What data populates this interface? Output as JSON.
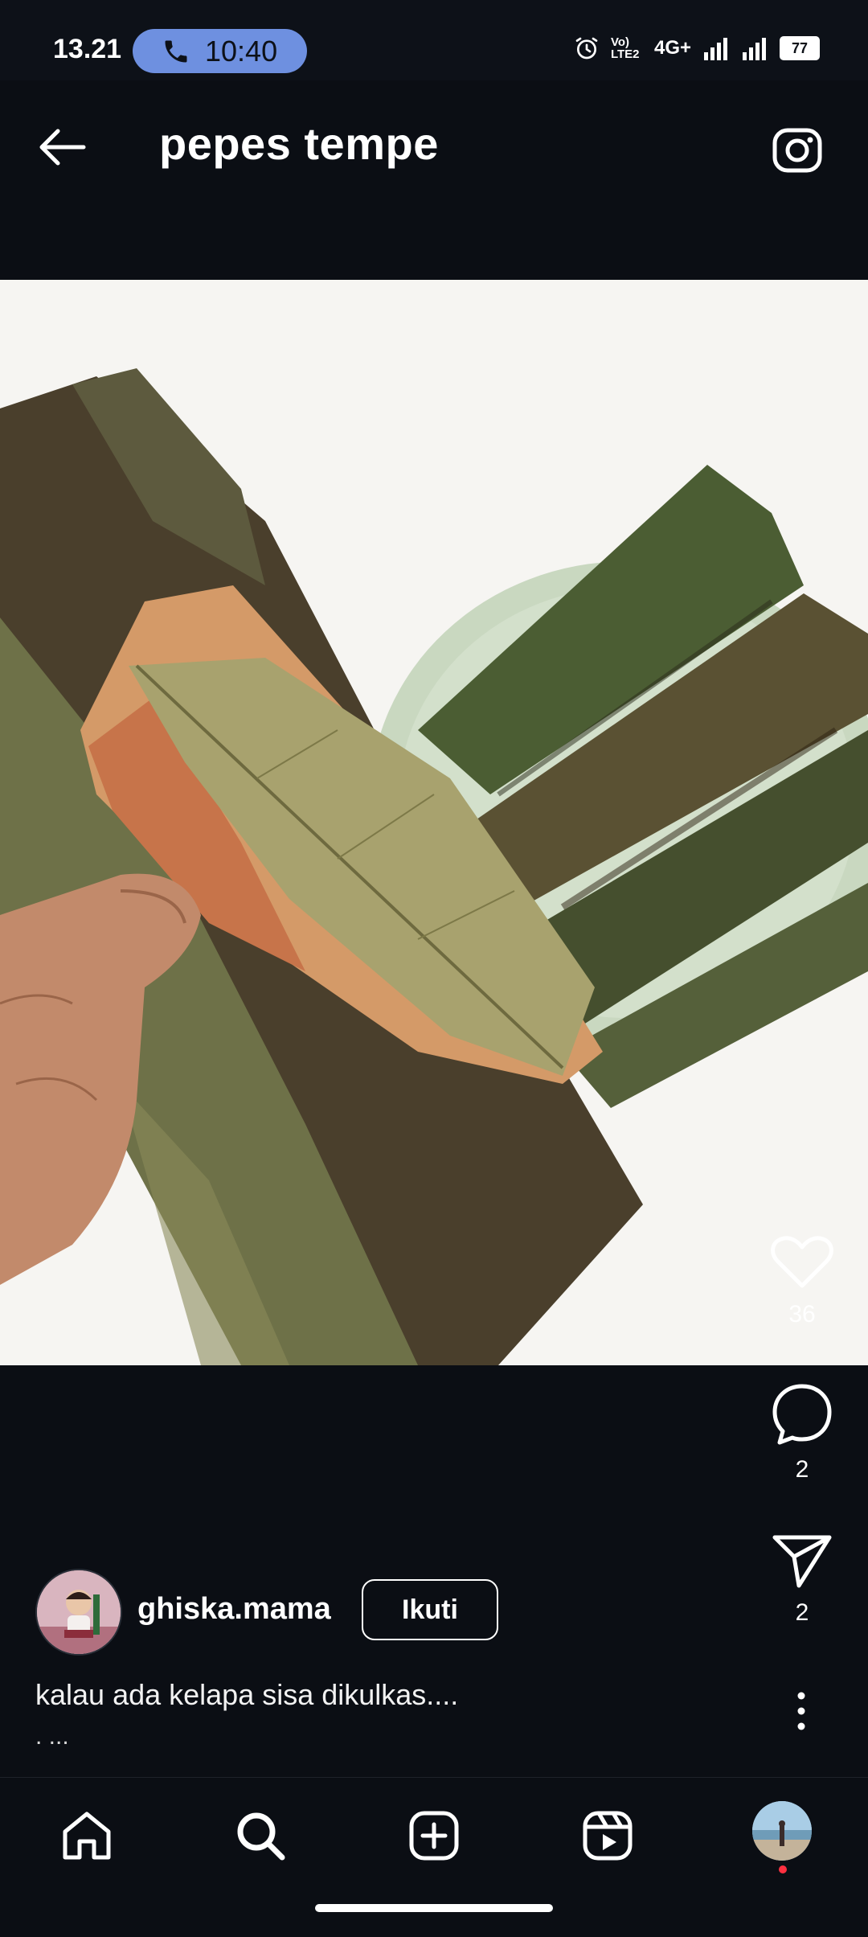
{
  "status_bar": {
    "time": "13.21",
    "call_time": "10:40",
    "network": "4G+",
    "volte": "Vo) LTE2",
    "battery": "77"
  },
  "header": {
    "title": "pepes tempe",
    "back_icon": "arrow-left-icon",
    "camera_icon": "camera-icon"
  },
  "post": {
    "likes": "36",
    "comments": "2",
    "shares": "2",
    "author": {
      "username": "ghiska.mama",
      "follow_label": "Ikuti"
    },
    "caption": "kalau ada kelapa sisa dikulkas....",
    "caption_more": ". ..."
  },
  "bottom_nav": {
    "items": [
      "home-icon",
      "search-icon",
      "create-icon",
      "reels-icon",
      "profile-avatar"
    ]
  },
  "colors": {
    "background": "#0b0e14",
    "call_pill": "#6e90e0",
    "notification_dot": "#ff3040"
  }
}
